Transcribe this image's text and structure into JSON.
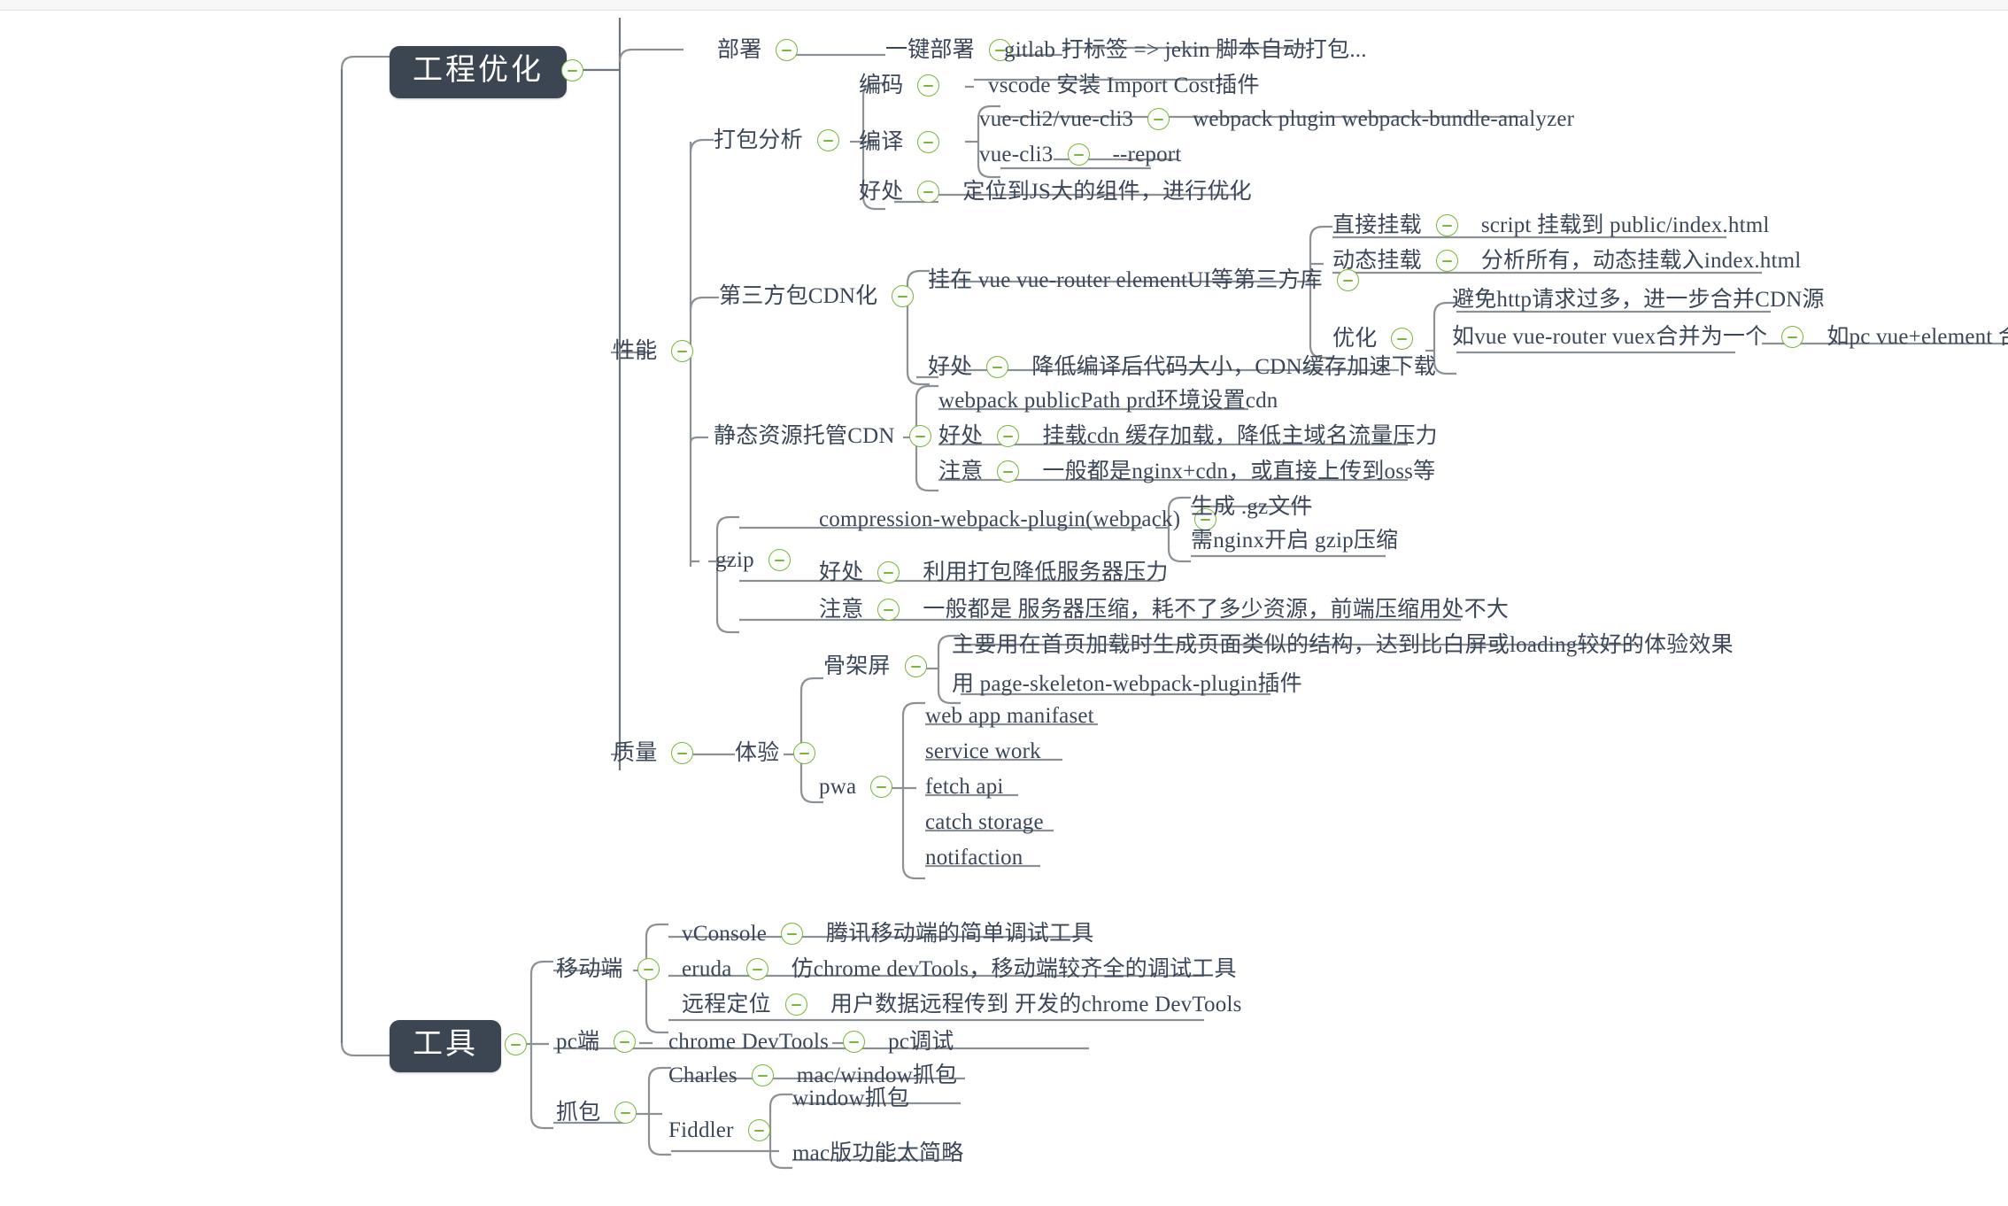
{
  "meta": {
    "app": "mind-map",
    "background": "#ffffff",
    "root_fill": "#3b4652",
    "root_text": "#ffffff",
    "text_color": "#3b4758",
    "toggle_color": "#7cb342",
    "edge_color": "#8c9196"
  },
  "roots": [
    {
      "id": "engineering",
      "label": "工程优化"
    },
    {
      "id": "tools",
      "label": "工具"
    }
  ],
  "nodes": {
    "deploy": "部署",
    "one_click_deploy": "一键部署",
    "gitlab_tag": "gitlab 打标签 => jekin 脚本自动打包...",
    "bundle_analysis": "打包分析",
    "coding": "编码",
    "vscode_import_cost": "vscode 安装 Import Cost插件",
    "compile": "编译",
    "vue_cli23": "vue-cli2/vue-cli3",
    "webpack_plugin_analyzer": "webpack plugin webpack-bundle-analyzer",
    "vue_cli3": "vue-cli3",
    "report": "--report",
    "bundle_benefit_label": "好处",
    "bundle_benefit": "定位到JS大的组件，进行优化",
    "performance": "性能",
    "third_party_cdn": "第三方包CDN化",
    "mount_libs": "挂在 vue vue-router elementUI等第三方库",
    "direct_mount": "直接挂载",
    "direct_mount_desc": "script 挂载到 public/index.html",
    "dynamic_mount": "动态挂载",
    "dynamic_mount_desc": "分析所有，动态挂载入index.html",
    "optimize": "优化",
    "optimize_desc1": "避免http请求过多，进一步合并CDN源",
    "optimize_desc2": "如vue vue-router vuex合并为一个",
    "optimize_desc3": "如pc  vue+element 合并",
    "cdn_benefit_label": "好处",
    "cdn_benefit": "降低编译后代码大小，CDN缓存加速下载",
    "static_cdn": "静态资源托管CDN",
    "public_path": "webpack  publicPath prd环境设置cdn",
    "static_benefit_label": "好处",
    "static_benefit": "挂载cdn 缓存加载，降低主域名流量压力",
    "static_note_label": "注意",
    "static_note": "一般都是nginx+cdn，或直接上传到oss等",
    "gzip": "gzip",
    "compression_plugin": "compression-webpack-plugin(webpack)",
    "gz_file": "生成 .gz文件",
    "nginx_gzip": "需nginx开启 gzip压缩",
    "gzip_benefit_label": "好处",
    "gzip_benefit": "利用打包降低服务器压力",
    "gzip_note_label": "注意",
    "gzip_note": "一般都是 服务器压缩，耗不了多少资源，前端压缩用处不大",
    "quality": "质量",
    "experience": "体验",
    "skeleton": "骨架屏",
    "skeleton_desc1": "主要用在首页加载时生成页面类似的结构，达到比白屏或loading较好的体验效果",
    "skeleton_desc2": "用 page-skeleton-webpack-plugin插件",
    "pwa": "pwa",
    "web_app_manifest": "web app manifaset",
    "service_work": "service work",
    "fetch_api": "fetch api",
    "catch_storage": "catch storage",
    "notifaction": "notifaction",
    "mobile": "移动端",
    "vconsole": "vConsole",
    "vconsole_desc": "腾讯移动端的简单调试工具",
    "eruda": "eruda",
    "eruda_desc": "仿chrome devTools，移动端较齐全的调试工具",
    "remote_debug": "远程定位",
    "remote_debug_desc": "用户数据远程传到 开发的chrome DevTools",
    "pc": "pc端",
    "chrome_devtools": "chrome DevTools",
    "pc_debug": "pc调试",
    "capture": "抓包",
    "charles": "Charles",
    "charles_desc": "mac/window抓包",
    "fiddler": "Fiddler",
    "fiddler_desc1": "window抓包",
    "fiddler_desc2": "mac版功能太简略"
  }
}
